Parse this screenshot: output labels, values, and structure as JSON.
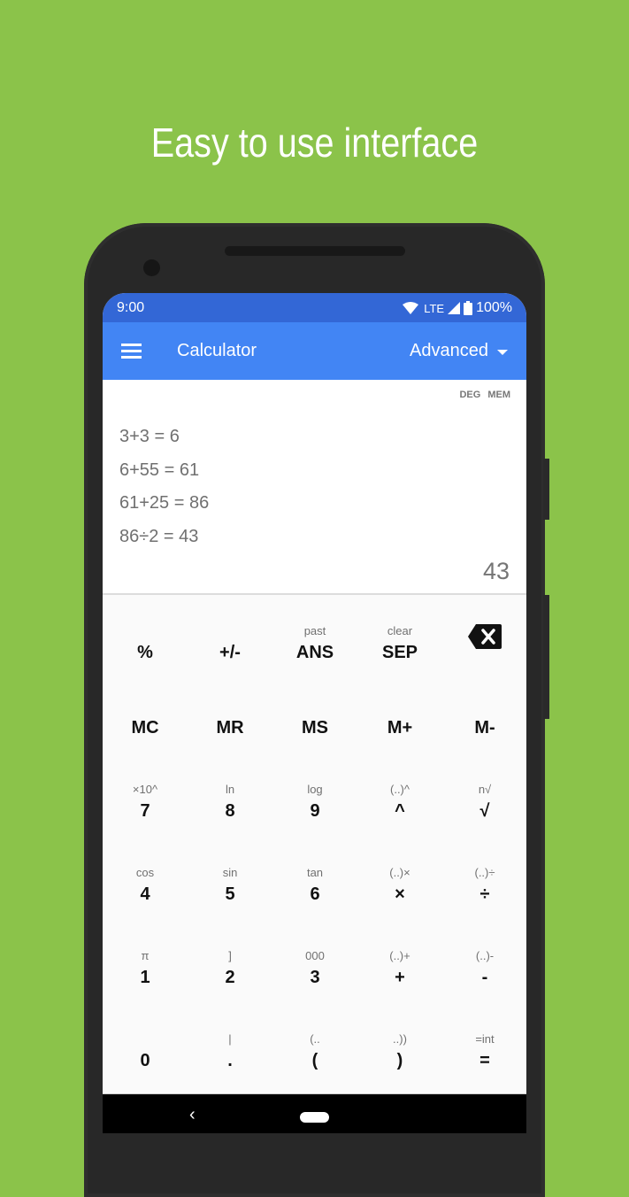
{
  "promo": {
    "headline": "Easy to use interface"
  },
  "status_bar": {
    "time": "9:00",
    "network": "LTE",
    "battery": "100%"
  },
  "app_bar": {
    "title": "Calculator",
    "mode": "Advanced"
  },
  "display": {
    "flags": [
      "DEG",
      "MEM"
    ],
    "history": [
      "3+3 = 6",
      "6+55 = 61",
      "61+25 = 86",
      "86÷2 = 43"
    ],
    "result": "43"
  },
  "keypad": {
    "rows": [
      [
        {
          "sec": "",
          "pri": "%",
          "name": "percent"
        },
        {
          "sec": "",
          "pri": "+/-",
          "name": "negate"
        },
        {
          "sec": "past",
          "pri": "ANS",
          "name": "ans"
        },
        {
          "sec": "clear",
          "pri": "SEP",
          "name": "sep"
        },
        {
          "sec": "",
          "pri": "",
          "name": "backspace",
          "icon": "backspace-icon"
        }
      ],
      [
        {
          "sec": "",
          "pri": "MC",
          "name": "mc"
        },
        {
          "sec": "",
          "pri": "MR",
          "name": "mr"
        },
        {
          "sec": "",
          "pri": "MS",
          "name": "ms"
        },
        {
          "sec": "",
          "pri": "M+",
          "name": "m-plus"
        },
        {
          "sec": "",
          "pri": "M-",
          "name": "m-minus"
        }
      ],
      [
        {
          "sec": "×10^",
          "pri": "7",
          "name": "7"
        },
        {
          "sec": "ln",
          "pri": "8",
          "name": "8"
        },
        {
          "sec": "log",
          "pri": "9",
          "name": "9"
        },
        {
          "sec": "(..)^",
          "pri": "^",
          "name": "power"
        },
        {
          "sec": "n√",
          "pri": "√",
          "name": "sqrt"
        }
      ],
      [
        {
          "sec": "cos",
          "pri": "4",
          "name": "4"
        },
        {
          "sec": "sin",
          "pri": "5",
          "name": "5"
        },
        {
          "sec": "tan",
          "pri": "6",
          "name": "6"
        },
        {
          "sec": "(..)×",
          "pri": "×",
          "name": "multiply"
        },
        {
          "sec": "(..)÷",
          "pri": "÷",
          "name": "divide"
        }
      ],
      [
        {
          "sec": "π",
          "pri": "1",
          "name": "1"
        },
        {
          "sec": "]",
          "pri": "2",
          "name": "2"
        },
        {
          "sec": "000",
          "pri": "3",
          "name": "3"
        },
        {
          "sec": "(..)+",
          "pri": "+",
          "name": "plus"
        },
        {
          "sec": "(..)-",
          "pri": "-",
          "name": "minus"
        }
      ],
      [
        {
          "sec": "",
          "pri": "0",
          "name": "0"
        },
        {
          "sec": "|",
          "pri": ".",
          "name": "decimal"
        },
        {
          "sec": "(..",
          "pri": "(",
          "name": "open-paren"
        },
        {
          "sec": "..))",
          "pri": ")",
          "name": "close-paren"
        },
        {
          "sec": "=int",
          "pri": "=",
          "name": "equals"
        }
      ]
    ]
  },
  "nav_bar": {
    "back_glyph": "‹"
  },
  "colors": {
    "background": "#8bc34a",
    "status_bar": "#3367d6",
    "app_bar": "#4285f4",
    "phone_body": "#282828"
  }
}
